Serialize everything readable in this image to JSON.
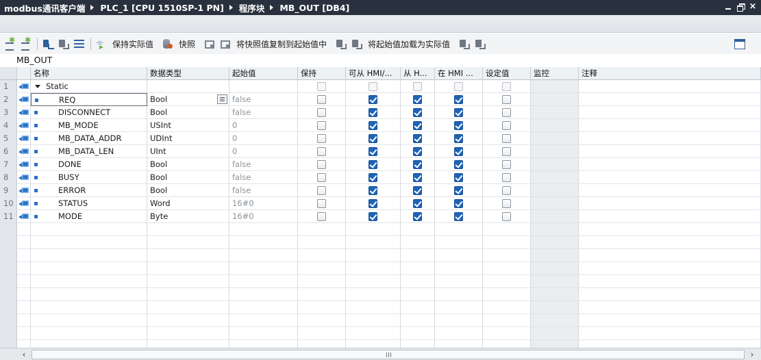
{
  "breadcrumb": [
    "modbus通讯客户端",
    "PLC_1 [CPU 1510SP-1 PN]",
    "程序块",
    "MB_OUT [DB4]"
  ],
  "window_controls": {
    "minimize": "minimize-icon",
    "restore": "restore-icon",
    "close": "×"
  },
  "toolbar": {
    "keep_actual": "保持实际值",
    "snapshot": "快照",
    "copy_snapshot": "将快照值复制到起始值中",
    "load_start": "将起始值加载为实际值"
  },
  "block_name": "MB_OUT",
  "columns": {
    "name": "名称",
    "type": "数据类型",
    "start": "起始值",
    "retain": "保持",
    "accessible": "可从 HMI/...",
    "visible": "从 H...",
    "in_hmi": "在 HMI ...",
    "setpoint": "设定值",
    "monitor": "监控",
    "comment": "注释"
  },
  "rows": [
    {
      "num": "1",
      "name": "Static",
      "type": "",
      "start": "",
      "retain": false,
      "accessible": false,
      "visible": false,
      "in_hmi": false,
      "setpoint": false,
      "is_group": true
    },
    {
      "num": "2",
      "name": "REQ",
      "type": "Bool",
      "start": "false",
      "retain": false,
      "accessible": true,
      "visible": true,
      "in_hmi": true,
      "setpoint": false,
      "selected": true
    },
    {
      "num": "3",
      "name": "DISCONNECT",
      "type": "Bool",
      "start": "false",
      "retain": false,
      "accessible": true,
      "visible": true,
      "in_hmi": true,
      "setpoint": false
    },
    {
      "num": "4",
      "name": "MB_MODE",
      "type": "USInt",
      "start": "0",
      "retain": false,
      "accessible": true,
      "visible": true,
      "in_hmi": true,
      "setpoint": false
    },
    {
      "num": "5",
      "name": "MB_DATA_ADDR",
      "type": "UDInt",
      "start": "0",
      "retain": false,
      "accessible": true,
      "visible": true,
      "in_hmi": true,
      "setpoint": false
    },
    {
      "num": "6",
      "name": "MB_DATA_LEN",
      "type": "UInt",
      "start": "0",
      "retain": false,
      "accessible": true,
      "visible": true,
      "in_hmi": true,
      "setpoint": false
    },
    {
      "num": "7",
      "name": "DONE",
      "type": "Bool",
      "start": "false",
      "retain": false,
      "accessible": true,
      "visible": true,
      "in_hmi": true,
      "setpoint": false
    },
    {
      "num": "8",
      "name": "BUSY",
      "type": "Bool",
      "start": "false",
      "retain": false,
      "accessible": true,
      "visible": true,
      "in_hmi": true,
      "setpoint": false
    },
    {
      "num": "9",
      "name": "ERROR",
      "type": "Bool",
      "start": "false",
      "retain": false,
      "accessible": true,
      "visible": true,
      "in_hmi": true,
      "setpoint": false
    },
    {
      "num": "10",
      "name": "STATUS",
      "type": "Word",
      "start": "16#0",
      "retain": false,
      "accessible": true,
      "visible": true,
      "in_hmi": true,
      "setpoint": false
    },
    {
      "num": "11",
      "name": "MODE",
      "type": "Byte",
      "start": "16#0",
      "retain": false,
      "accessible": true,
      "visible": true,
      "in_hmi": true,
      "setpoint": false
    }
  ],
  "empty_rows": 10,
  "colors": {
    "titlebar": "#28313d",
    "checkbox_checked": "#1f63b8",
    "variable_icon": "#2a6fc1"
  }
}
